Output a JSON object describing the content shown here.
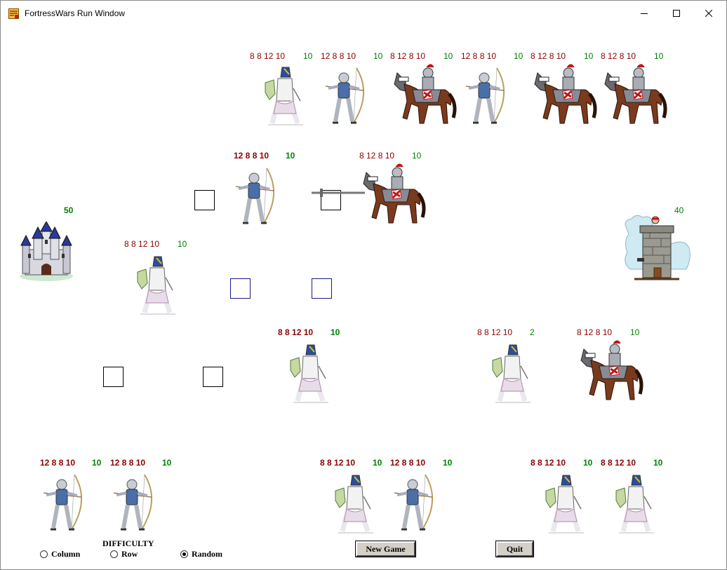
{
  "window": {
    "title": "FortressWars Run Window",
    "controls": [
      "minimize-icon",
      "maximize-icon",
      "close-icon"
    ]
  },
  "colors": {
    "stats": "#8b0000",
    "health": "#008000",
    "cell_black": "#000000",
    "cell_blue": "#1a1a8c"
  },
  "fortresses": {
    "player": {
      "health": "50",
      "icon": "castle-icon"
    },
    "enemy": {
      "health": "40",
      "icon": "tower-icon"
    }
  },
  "board_units": [
    {
      "type": "archer",
      "stats": "12 8 8 10",
      "health": "10",
      "bold": true
    },
    {
      "type": "knight",
      "stats": "8 12 8 10",
      "health": "10",
      "bold": false
    },
    {
      "type": "swordsman",
      "stats": "8 8 12 10",
      "health": "10",
      "bold": false
    },
    {
      "type": "swordsman",
      "stats": "8 8 12 10",
      "health": "10",
      "bold": true
    },
    {
      "type": "swordsman",
      "stats": "8 8 12 10",
      "health": "2",
      "bold": false
    },
    {
      "type": "knight",
      "stats": "8 12 8 10",
      "health": "10",
      "bold": false
    }
  ],
  "enemy_hand": [
    {
      "type": "swordsman",
      "stats": "8 8 12 10",
      "health": "10"
    },
    {
      "type": "archer",
      "stats": "12 8 8 10",
      "health": "10"
    },
    {
      "type": "knight",
      "stats": "8 12 8 10",
      "health": "10"
    },
    {
      "type": "archer",
      "stats": "12 8 8 10",
      "health": "10"
    },
    {
      "type": "knight",
      "stats": "8 12 8 10",
      "health": "10"
    },
    {
      "type": "knight",
      "stats": "8 12 8 10",
      "health": "10"
    }
  ],
  "player_hand": [
    {
      "type": "archer",
      "stats": "12 8 8 10",
      "health": "10"
    },
    {
      "type": "archer",
      "stats": "12 8 8 10",
      "health": "10"
    },
    {
      "type": "swordsman",
      "stats": "8 8 12 10",
      "health": "10"
    },
    {
      "type": "archer",
      "stats": "12 8 8 10",
      "health": "10"
    },
    {
      "type": "swordsman",
      "stats": "8 8 12 10",
      "health": "10"
    },
    {
      "type": "swordsman",
      "stats": "8 8 12 10",
      "health": "10"
    }
  ],
  "difficulty": {
    "label": "DIFFICULTY",
    "options": [
      "Column",
      "Row",
      "Random"
    ],
    "selected": "Random"
  },
  "buttons": {
    "new_game": "New Game",
    "quit": "Quit"
  }
}
